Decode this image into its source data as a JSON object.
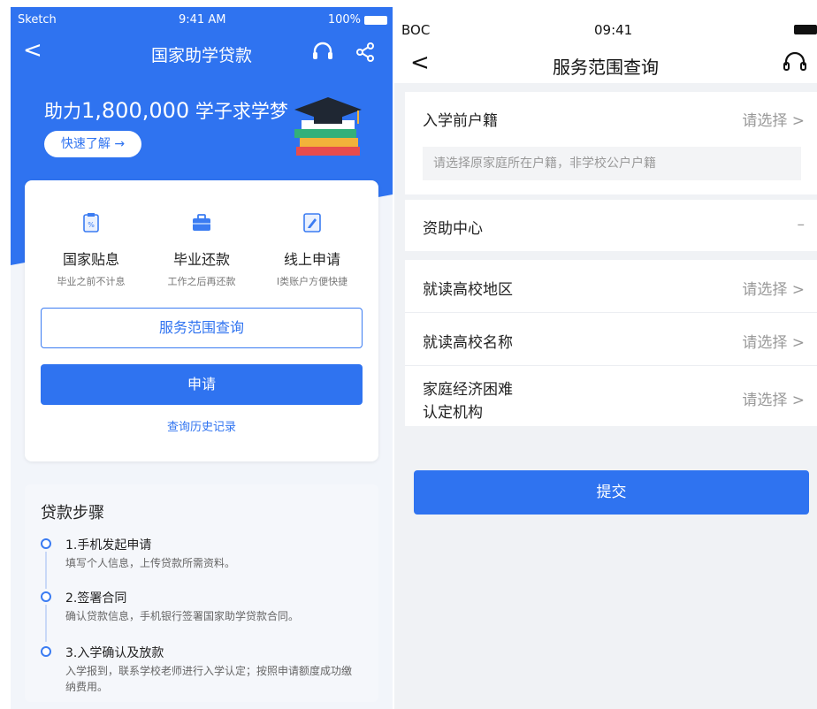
{
  "left": {
    "status": {
      "carrier": "Sketch",
      "time": "9:41 AM",
      "battery": "100%"
    },
    "nav": {
      "back": "<",
      "title": "国家助学贷款",
      "icons": [
        "headset-icon",
        "share-icon"
      ]
    },
    "hero": {
      "prefix": "助力",
      "number": "1,800,000",
      "suffix": "学子求学梦",
      "button": "快速了解 →"
    },
    "features": [
      {
        "icon": "percent-clipboard-icon",
        "title": "国家贴息",
        "sub": "毕业之前不计息"
      },
      {
        "icon": "briefcase-icon",
        "title": "毕业还款",
        "sub": "工作之后再还款"
      },
      {
        "icon": "edit-form-icon",
        "title": "线上申请",
        "sub": "I类账户方便快捷"
      }
    ],
    "service_button": "服务范围查询",
    "apply_button": "申请",
    "history_link": "查询历史记录",
    "steps": {
      "heading": "贷款步骤",
      "items": [
        {
          "title": "1.手机发起申请",
          "desc": "填写个人信息，上传贷款所需资料。"
        },
        {
          "title": "2.签署合同",
          "desc": "确认贷款信息，手机银行签署国家助学贷款合同。"
        },
        {
          "title": "3.入学确认及放款",
          "desc": "入学报到，联系学校老师进行入学认定；按照申请额度成功缴纳费用。"
        }
      ]
    }
  },
  "right": {
    "status": {
      "carrier": "BOC",
      "time": "09:41"
    },
    "nav": {
      "back": "<",
      "title": "服务范围查询",
      "icon": "headset-icon"
    },
    "fields": {
      "household": {
        "label": "入学前户籍",
        "value": "请选择 >",
        "hint": "请选择原家庭所在户籍，非学校公户户籍"
      },
      "center": {
        "label": "资助中心",
        "value": "–"
      },
      "region": {
        "label": "就读高校地区",
        "value": "请选择 >"
      },
      "school": {
        "label": "就读高校名称",
        "value": "请选择 >"
      },
      "agency": {
        "label_line1": "家庭经济困难",
        "label_line2": "认定机构",
        "value": "请选择 >"
      }
    },
    "submit": "提交"
  },
  "colors": {
    "primary": "#2f73f0",
    "background": "#f0f2f5"
  }
}
